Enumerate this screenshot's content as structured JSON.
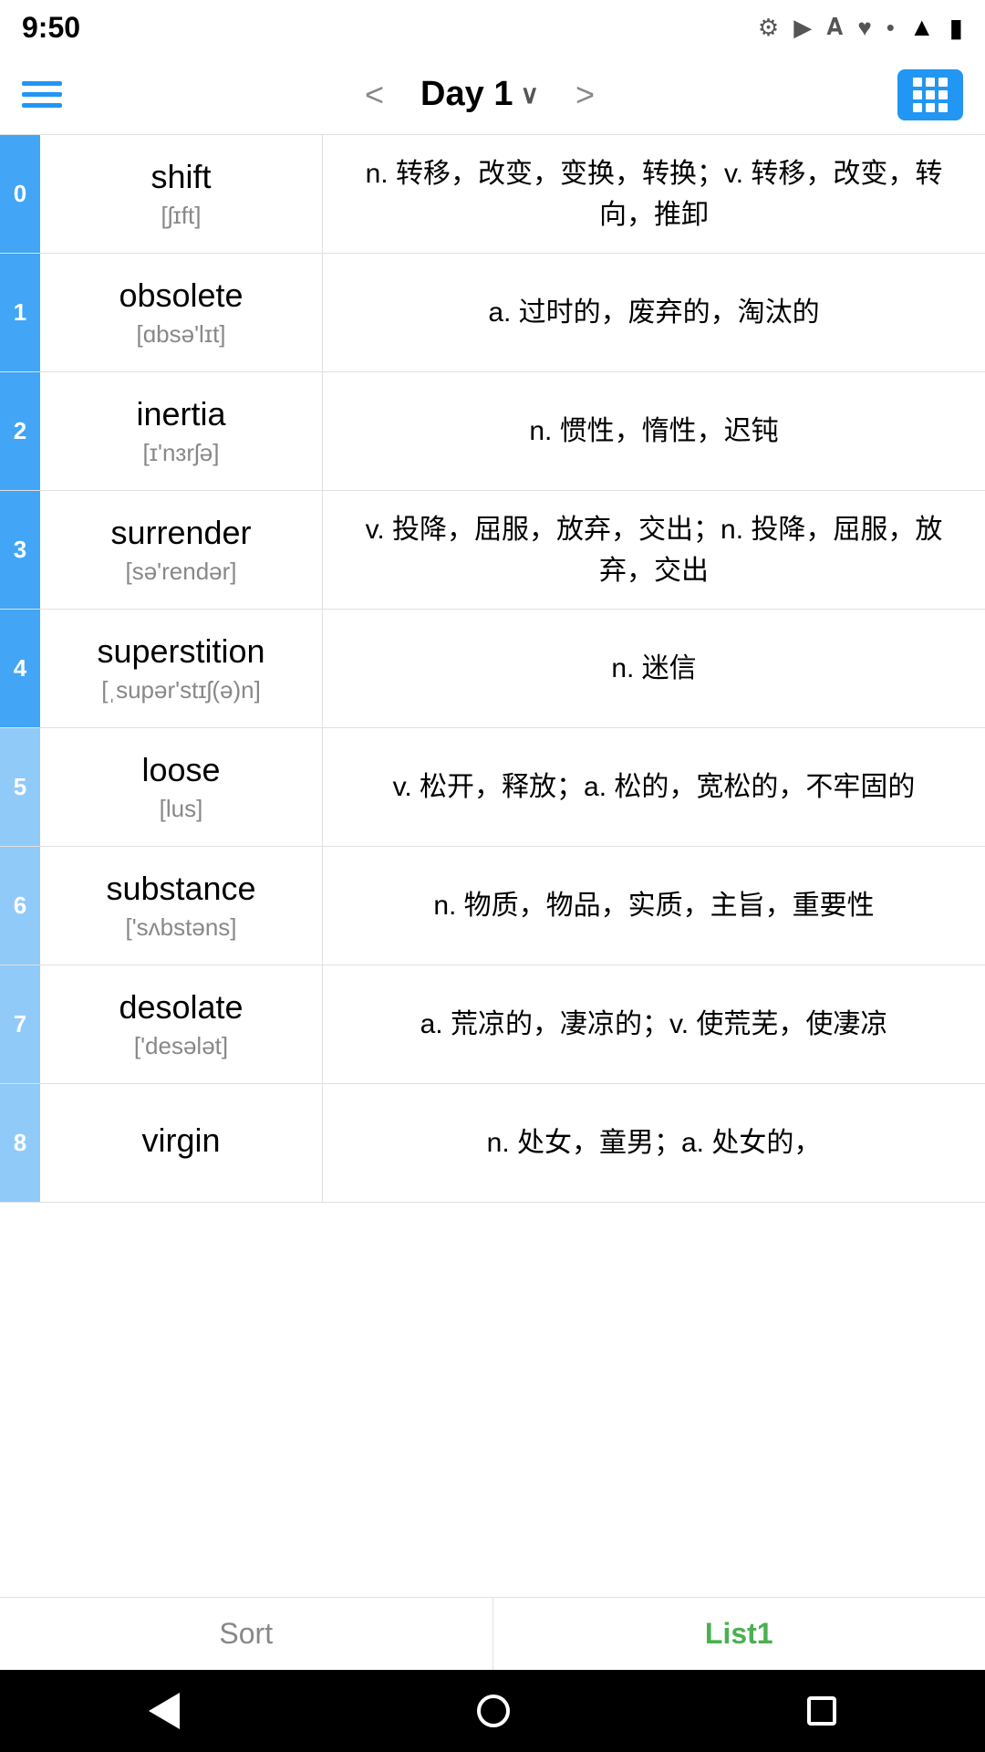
{
  "statusBar": {
    "time": "9:50",
    "icons": [
      "gear",
      "play",
      "text",
      "wifi",
      "dot"
    ]
  },
  "toolbar": {
    "menuLabel": "menu",
    "prevLabel": "<",
    "nextLabel": ">",
    "title": "Day 1",
    "titleChevron": "∨",
    "gridLabel": "grid-view"
  },
  "words": [
    {
      "index": "0",
      "indexLight": false,
      "word": "shift",
      "phonetic": "[ʃɪft]",
      "definition": "n. 转移，改变，变换，转换；v. 转移，改变，转向，推卸"
    },
    {
      "index": "1",
      "indexLight": false,
      "word": "obsolete",
      "phonetic": "[ɑbsə'lɪt]",
      "definition": "a. 过时的，废弃的，淘汰的"
    },
    {
      "index": "2",
      "indexLight": false,
      "word": "inertia",
      "phonetic": "[ɪ'nɜrʃə]",
      "definition": "n. 惯性，惰性，迟钝"
    },
    {
      "index": "3",
      "indexLight": false,
      "word": "surrender",
      "phonetic": "[sə'rendər]",
      "definition": "v. 投降，屈服，放弃，交出；n. 投降，屈服，放弃，交出"
    },
    {
      "index": "4",
      "indexLight": false,
      "word": "superstition",
      "phonetic": "[ˌsupər'stɪʃ(ə)n]",
      "definition": "n. 迷信"
    },
    {
      "index": "5",
      "indexLight": true,
      "word": "loose",
      "phonetic": "[lus]",
      "definition": "v. 松开，释放；a. 松的，宽松的，不牢固的"
    },
    {
      "index": "6",
      "indexLight": true,
      "word": "substance",
      "phonetic": "['sʌbstəns]",
      "definition": "n. 物质，物品，实质，主旨，重要性"
    },
    {
      "index": "7",
      "indexLight": true,
      "word": "desolate",
      "phonetic": "['desələt]",
      "definition": "a. 荒凉的，凄凉的；v. 使荒芜，使凄凉"
    },
    {
      "index": "8",
      "indexLight": true,
      "word": "virgin",
      "phonetic": "",
      "definition": "n. 处女，童男；a. 处女的，"
    }
  ],
  "bottomTab": {
    "sortLabel": "Sort",
    "list1Label": "List1"
  },
  "navBar": {
    "backLabel": "back",
    "homeLabel": "home",
    "recentLabel": "recent"
  }
}
